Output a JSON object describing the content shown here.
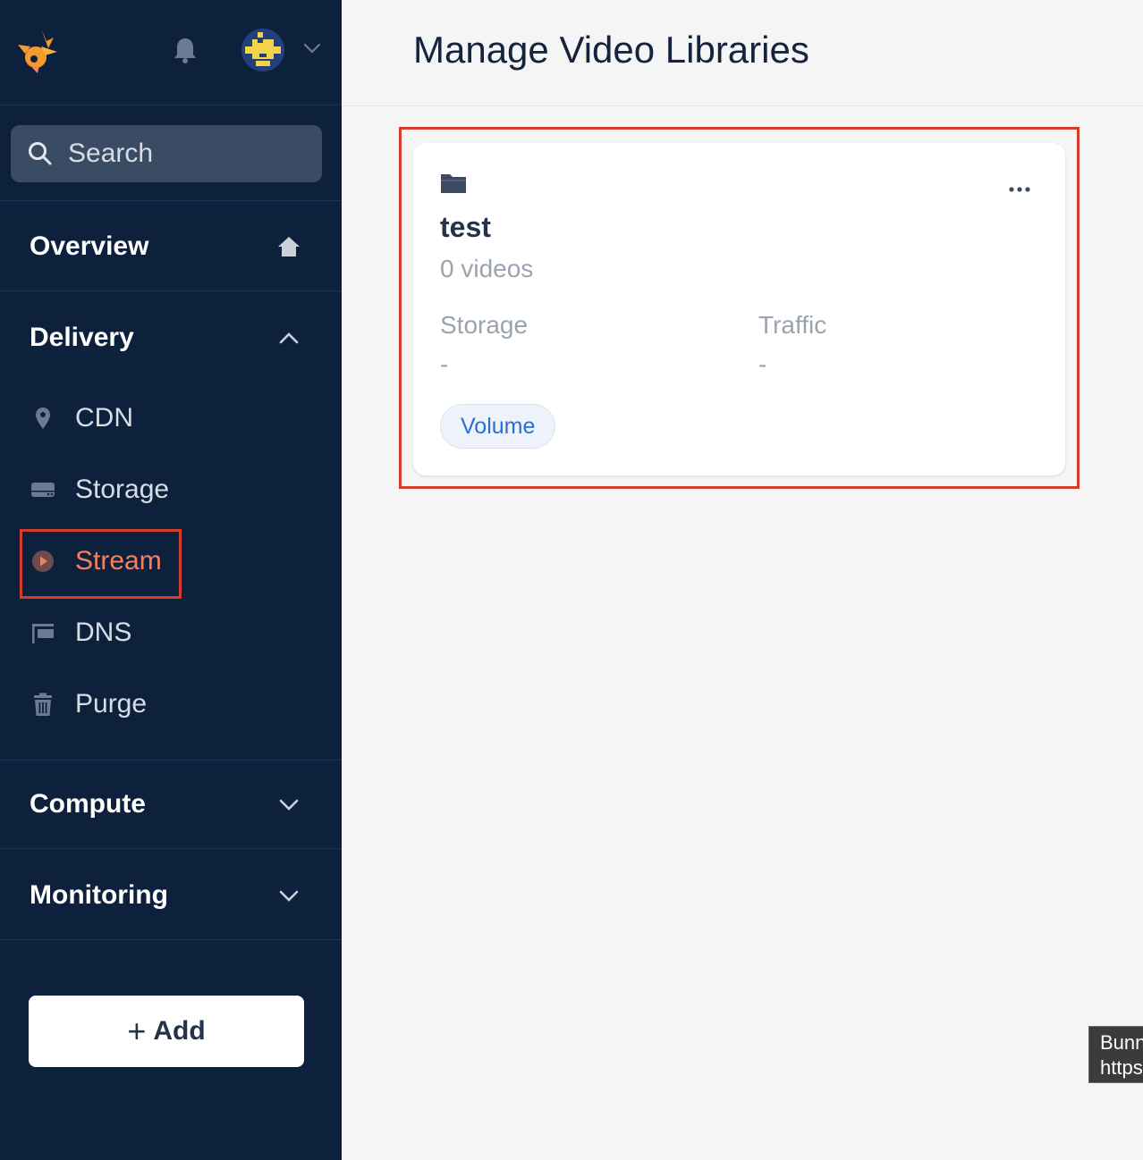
{
  "sidebar": {
    "search": {
      "placeholder": "Search"
    },
    "sections": {
      "overview": "Overview",
      "delivery": "Delivery",
      "compute": "Compute",
      "monitoring": "Monitoring"
    },
    "delivery_items": [
      {
        "label": "CDN",
        "icon": "location-pin-icon"
      },
      {
        "label": "Storage",
        "icon": "drive-icon"
      },
      {
        "label": "Stream",
        "icon": "play-circle-icon",
        "active": true
      },
      {
        "label": "DNS",
        "icon": "flag-icon"
      },
      {
        "label": "Purge",
        "icon": "trash-icon"
      }
    ],
    "add_button": {
      "plus": "+",
      "label": "Add"
    }
  },
  "page": {
    "title": "Manage Video Libraries"
  },
  "library_card": {
    "name": "test",
    "count": "0 videos",
    "storage_label": "Storage",
    "storage_value": "-",
    "traffic_label": "Traffic",
    "traffic_value": "-",
    "tag": "Volume"
  },
  "tooltip": {
    "line1": "Bunn",
    "line2": "https"
  },
  "colors": {
    "sidebar_bg": "#0d213d",
    "accent": "#f4805e",
    "highlight": "#d23d2c",
    "link_blue": "#2a6fd0"
  }
}
